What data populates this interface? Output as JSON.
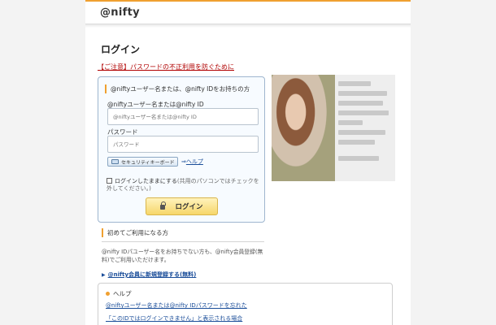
{
  "header": {
    "logo": "@nifty"
  },
  "page": {
    "title": "ログイン",
    "warning_link": "【ご注意】パスワードの不正利用を防ぐために"
  },
  "login_box": {
    "heading": "@niftyユーザー名または、@nifty IDをお持ちの方",
    "username_label": "@niftyユーザー名または@nifty ID",
    "username_placeholder": "@niftyユーザー名または@nifty ID",
    "password_label": "パスワード",
    "password_placeholder": "パスワード",
    "keyboard_button": "セキュリティキーボード",
    "help_arrow": "⇒",
    "help_link": "ヘルプ",
    "keep_logged_in": "ログインしたままにする",
    "keep_note": "(共用のパソコンではチェックを外してください。)",
    "login_button": "ログイン"
  },
  "first_time": {
    "heading": "初めてご利用になる方",
    "description": "@nifty IDパユーザー名をお持ちでない方も、@nifty会員登録(無料)でご利用いただけます。",
    "register_link": "@nifty会員に新規登録する(無料)"
  },
  "help": {
    "heading": "ヘルプ",
    "items": [
      "@niftyユーザー名または@nifty IDパスワードを忘れた",
      "「このIDではログインできません」と表示される場合"
    ]
  },
  "colors": {
    "accent": "#f0a030",
    "link": "#1a4d99",
    "warning": "#b00000"
  }
}
